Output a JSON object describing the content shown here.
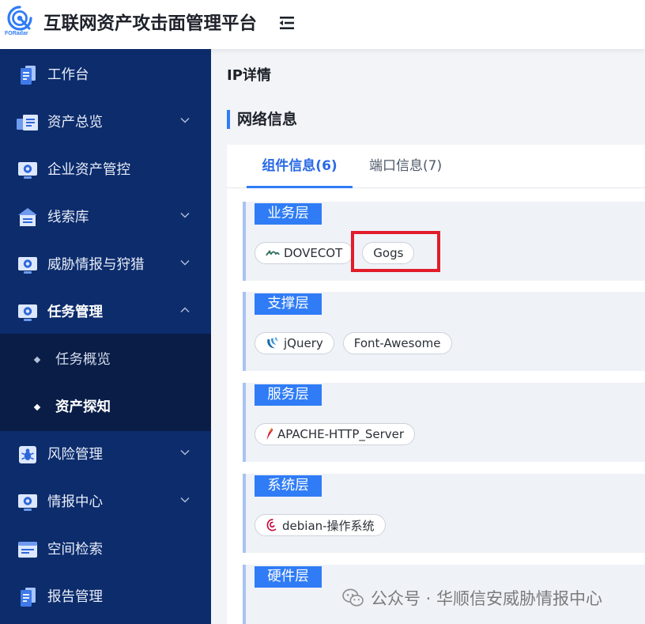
{
  "header": {
    "logo_text": "FORadar",
    "logo_icon": "radar-logo-icon",
    "title": "互联网资产攻击面管理平台",
    "menu_toggle_icon": "collapse-menu-icon"
  },
  "colors": {
    "accent": "#2f7cf6",
    "sidebar-bg": "#0c2c6c",
    "submenu-bg": "#091d47",
    "highlight": "#e11d2a",
    "layer-bg": "#eff2f7",
    "layer-border": "#a7c3f4"
  },
  "sidebar": {
    "items": [
      {
        "label": "工作台",
        "icon": "document-icon"
      },
      {
        "label": "资产总览",
        "icon": "cards-icon",
        "chevron": "chevron-down-icon"
      },
      {
        "label": "企业资产管控",
        "icon": "monitor-icon"
      },
      {
        "label": "线索库",
        "icon": "house-icon",
        "chevron": "chevron-down-icon"
      },
      {
        "label": "威胁情报与狩猎",
        "icon": "monitor-icon",
        "chevron": "chevron-down-icon"
      },
      {
        "label": "任务管理",
        "icon": "monitor-icon",
        "chevron": "chevron-up-icon",
        "expanded": true,
        "children": [
          {
            "label": "任务概览"
          },
          {
            "label": "资产探知",
            "active": true
          }
        ]
      },
      {
        "label": "风险管理",
        "icon": "bug-icon",
        "chevron": "chevron-down-icon"
      },
      {
        "label": "情报中心",
        "icon": "monitor-icon",
        "chevron": "chevron-down-icon"
      },
      {
        "label": "空间检索",
        "icon": "panel-icon"
      },
      {
        "label": "报告管理",
        "icon": "document-icon"
      }
    ]
  },
  "main": {
    "page_title": "IP详情",
    "section_title": "网络信息",
    "tabs": [
      {
        "label": "组件信息(6)",
        "active": true
      },
      {
        "label": "端口信息(7)"
      }
    ],
    "layers": [
      {
        "name": "业务层",
        "components": [
          {
            "name": "DOVECOT",
            "icon": "dovecot-icon"
          },
          {
            "name": "Gogs",
            "highlighted": true
          }
        ]
      },
      {
        "name": "支撑层",
        "components": [
          {
            "name": "jQuery",
            "icon": "jquery-icon"
          },
          {
            "name": "Font-Awesome"
          }
        ]
      },
      {
        "name": "服务层",
        "components": [
          {
            "name": "APACHE-HTTP_Server",
            "icon": "apache-feather-icon"
          }
        ]
      },
      {
        "name": "系统层",
        "components": [
          {
            "name": "debian-操作系统",
            "icon": "debian-icon"
          }
        ]
      },
      {
        "name": "硬件层",
        "components": []
      }
    ]
  },
  "watermark": {
    "icon": "wechat-icon",
    "text": "公众号 · 华顺信安威胁情报中心"
  }
}
